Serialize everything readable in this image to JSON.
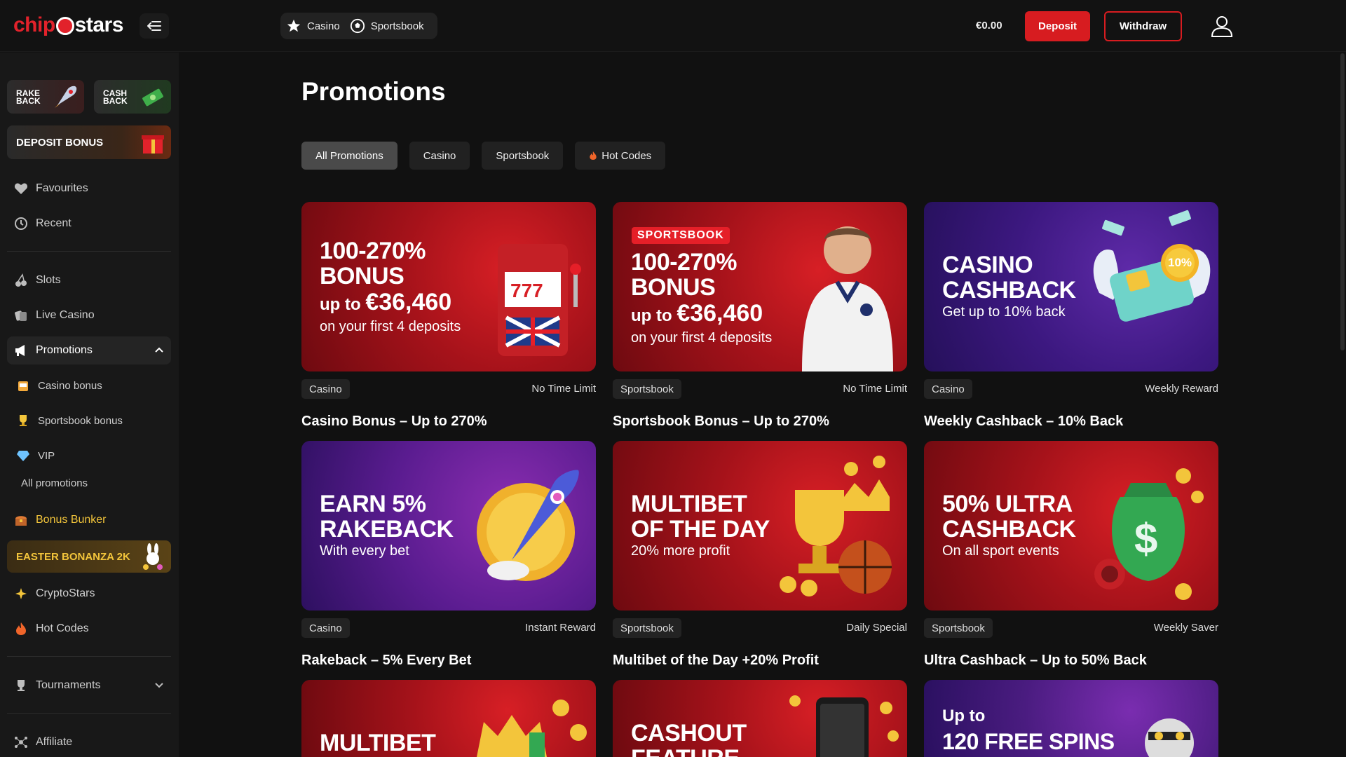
{
  "logo": {
    "part1": "chip",
    "part2": "stars"
  },
  "topnav": {
    "items": [
      {
        "label": "Casino",
        "icon": "star-icon"
      },
      {
        "label": "Sportsbook",
        "icon": "soccer-ball-icon"
      }
    ]
  },
  "account": {
    "balance": "€0.00",
    "deposit_label": "Deposit",
    "withdraw_label": "Withdraw"
  },
  "sidebar": {
    "rakeback_label": "RAKE\nBACK",
    "cashback_label": "CASH\nBACK",
    "deposit_bonus_label": "DEPOSIT BONUS",
    "items": [
      {
        "label": "Favourites",
        "icon": "heart-icon"
      },
      {
        "label": "Recent",
        "icon": "history-icon"
      },
      {
        "label": "Slots",
        "icon": "cherries-icon"
      },
      {
        "label": "Live Casino",
        "icon": "dealer-icon"
      },
      {
        "label": "Promotions",
        "icon": "megaphone-icon"
      },
      {
        "label": "Casino bonus",
        "icon": "slot-machine-icon"
      },
      {
        "label": "Sportsbook bonus",
        "icon": "trophy-icon"
      },
      {
        "label": "VIP",
        "icon": "diamond-icon"
      },
      {
        "label": "All promotions"
      },
      {
        "label": "Bonus Bunker",
        "icon": "treasure-chest-icon"
      },
      {
        "label": "CryptoStars",
        "icon": "crypto-icon"
      },
      {
        "label": "Hot Codes",
        "icon": "fire-icon"
      },
      {
        "label": "Tournaments",
        "icon": "trophy-outline-icon"
      },
      {
        "label": "Affiliate",
        "icon": "network-icon"
      }
    ],
    "easter_label": "EASTER BONANZA 2K"
  },
  "main": {
    "title": "Promotions",
    "filters": [
      {
        "label": "All Promotions"
      },
      {
        "label": "Casino"
      },
      {
        "label": "Sportsbook"
      },
      {
        "label": "Hot Codes",
        "icon": "fire-icon"
      }
    ],
    "cards": [
      {
        "badge": "Casino",
        "meta": "No Time Limit",
        "title": "Casino Bonus – Up to 270%",
        "banner": {
          "line1": "100-270%",
          "line2": "BONUS",
          "line3a": "up to",
          "line3b": "€36,460",
          "line4": "on your first 4 deposits"
        }
      },
      {
        "badge": "Sportsbook",
        "meta": "No Time Limit",
        "title": "Sportsbook Bonus – Up to 270%",
        "banner": {
          "tag": "SPORTSBOOK",
          "line1": "100-270%",
          "line2": "BONUS",
          "line3a": "up to",
          "line3b": "€36,460",
          "line4": "on your first 4 deposits"
        }
      },
      {
        "badge": "Casino",
        "meta": "Weekly Reward",
        "title": "Weekly Cashback – 10% Back",
        "banner": {
          "line1": "CASINO",
          "line2": "CASHBACK",
          "line3": "Get up to 10% back",
          "coin": "10%"
        }
      },
      {
        "badge": "Casino",
        "meta": "Instant Reward",
        "title": "Rakeback – 5% Every Bet",
        "banner": {
          "line1": "EARN 5%",
          "line2": "RAKEBACK",
          "line3": "With every bet"
        }
      },
      {
        "badge": "Sportsbook",
        "meta": "Daily Special",
        "title": "Multibet of the Day +20% Profit",
        "banner": {
          "line1": "MULTIBET",
          "line2": "OF THE DAY",
          "line3": "20% more profit"
        }
      },
      {
        "badge": "Sportsbook",
        "meta": "Weekly Saver",
        "title": "Ultra Cashback – Up to 50% Back",
        "banner": {
          "line1": "50% ULTRA",
          "line2": "CASHBACK",
          "line3": "On all sport events"
        }
      },
      {
        "banner": {
          "line1": "MULTIBET"
        }
      },
      {
        "banner": {
          "line1": "CASHOUT",
          "line2": "FEATURE"
        }
      },
      {
        "banner": {
          "line1": "Up to",
          "line2": "120 FREE SPINS"
        }
      }
    ]
  },
  "colors": {
    "accent": "#d71c20",
    "gold": "#f3c53b",
    "background": "#111111",
    "sidebar": "#181818"
  }
}
